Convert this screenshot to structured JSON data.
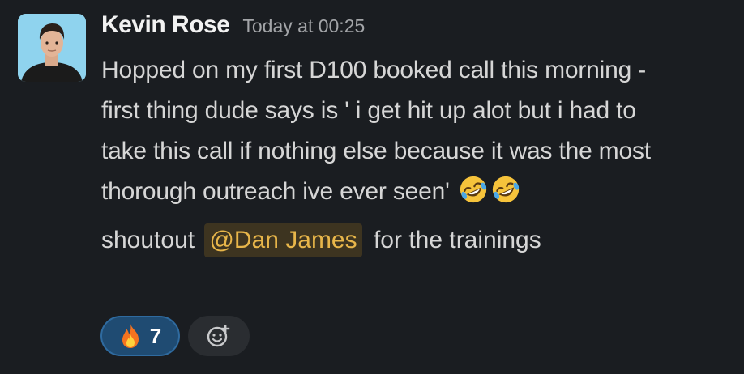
{
  "message": {
    "author": "Kevin Rose",
    "timestamp": "Today at 00:25",
    "body_lines": [
      "Hopped on my first D100 booked call this morning -",
      "first thing dude says is ' i get hit up alot but i had to",
      "take this call if nothing else because it was the most",
      "thorough outreach ive ever seen'"
    ],
    "inline_emojis": [
      "rolling-on-floor-laughing",
      "rolling-on-floor-laughing"
    ],
    "shoutout": {
      "prefix": "shoutout",
      "mention": "@Dan James",
      "suffix": "for the trainings"
    }
  },
  "reactions": [
    {
      "emoji": "fire",
      "count": "7",
      "active": true
    },
    {
      "emoji": "add-reaction",
      "count": null,
      "active": false
    }
  ],
  "colors": {
    "background": "#1a1d21",
    "mention_bg": "#3d3420",
    "mention_text": "#e8b64a",
    "reaction_active_bg": "#1f4b72"
  }
}
